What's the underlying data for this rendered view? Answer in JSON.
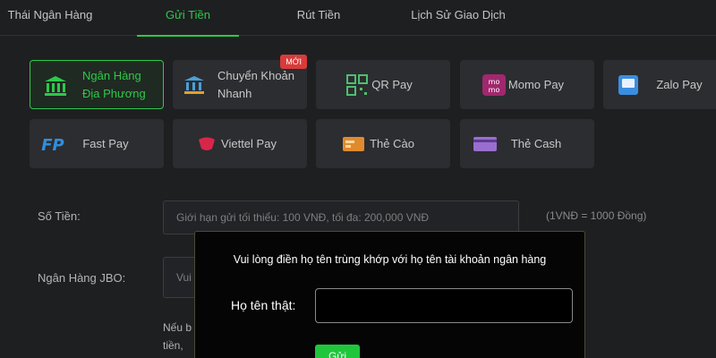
{
  "tabs": [
    {
      "label": "Thái Ngân Hàng"
    },
    {
      "label": "Gửi Tiền",
      "active": true
    },
    {
      "label": "Rút Tiền"
    },
    {
      "label": "Lịch Sử Giao Dịch"
    }
  ],
  "methods": [
    {
      "line1": "Ngân Hàng",
      "line2": "Địa Phương",
      "active": true
    },
    {
      "line1": "Chuyển Khoản",
      "line2": "Nhanh",
      "badge": "MỚI"
    },
    {
      "label": "QR Pay"
    },
    {
      "label": "Momo Pay"
    },
    {
      "label": "Zalo Pay"
    },
    {
      "label": "Fast Pay"
    },
    {
      "label": "Viettel Pay"
    },
    {
      "label": "Thẻ Cào"
    },
    {
      "label": "Thẻ Cash"
    }
  ],
  "form": {
    "amount_label": "Số Tiền:",
    "amount_placeholder": "Giới hạn gửi tối thiểu: 100 VNĐ, tối đa: 200,000 VNĐ",
    "rate_note": "(1VNĐ = 1000 Đồng)",
    "bank_label": "Ngân Hàng JBO:",
    "bank_placeholder": "Vui",
    "hint_line1": "Nếu b",
    "hint_line2": "tiền,"
  },
  "dialog": {
    "message": "Vui lòng điền họ tên trùng khớp với họ tên tài khoản ngân hàng",
    "name_label": "Họ tên thật:",
    "name_value": "",
    "confirm_label": "Gửi"
  },
  "colors": {
    "accent": "#2ec84a",
    "badge": "#d93b3b",
    "background": "#1e1f21",
    "tile": "#2c2d30"
  }
}
